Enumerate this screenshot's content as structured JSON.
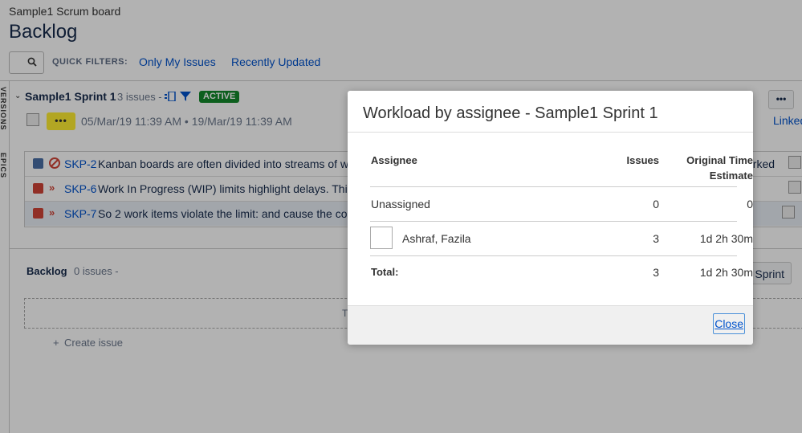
{
  "header": {
    "project_name": "Sample1 Scrum board",
    "page_title": "Backlog",
    "quick_filters_label": "QUICK FILTERS:",
    "quick_filters": [
      "Only My Issues",
      "Recently Updated"
    ]
  },
  "side_tabs": [
    "VERSIONS",
    "EPICS"
  ],
  "sprint": {
    "name": "Sample1 Sprint 1",
    "count_text": "3 issues -",
    "status": "ACTIVE",
    "more_label": "•••",
    "dates": "05/Mar/19 11:39 AM • 19/Mar/19 11:39 AM",
    "linked_text": "Linked",
    "issues": [
      {
        "key": "SKP-2",
        "summary": "Kanban boards are often divided into streams of work",
        "type_icon": "task-icon",
        "type_color": "#4a6fa5",
        "priority_icon": "blocker-icon"
      },
      {
        "key": "SKP-6",
        "summary": "Work In Progress (WIP) limits highlight delays. This co",
        "type_icon": "bug-icon",
        "type_color": "#d04437",
        "priority_icon": "major-priority-icon"
      },
      {
        "key": "SKP-7",
        "summary": "So 2 work items violate the limit: and cause the colum",
        "type_icon": "bug-icon",
        "type_color": "#d04437",
        "priority_icon": "major-priority-icon"
      }
    ],
    "row_trailing_text": "arked"
  },
  "backlog": {
    "title": "Backlog",
    "count_text": "0 issues -",
    "dropzone_text": "T",
    "create_issue": "Create issue",
    "sprint_button": "Sprint"
  },
  "dialog": {
    "title": "Workload by assignee - Sample1 Sprint 1",
    "columns": {
      "assignee": "Assignee",
      "issues": "Issues",
      "estimate_line1": "Original Time",
      "estimate_line2": "Estimate"
    },
    "rows": [
      {
        "assignee": "Unassigned",
        "issues": "0",
        "estimate": "0",
        "avatar": false
      },
      {
        "assignee": "Ashraf, Fazila",
        "issues": "3",
        "estimate": "1d 2h 30m",
        "avatar": true
      }
    ],
    "total": {
      "label": "Total:",
      "issues": "3",
      "estimate": "1d 2h 30m"
    },
    "close_label": "Close"
  }
}
